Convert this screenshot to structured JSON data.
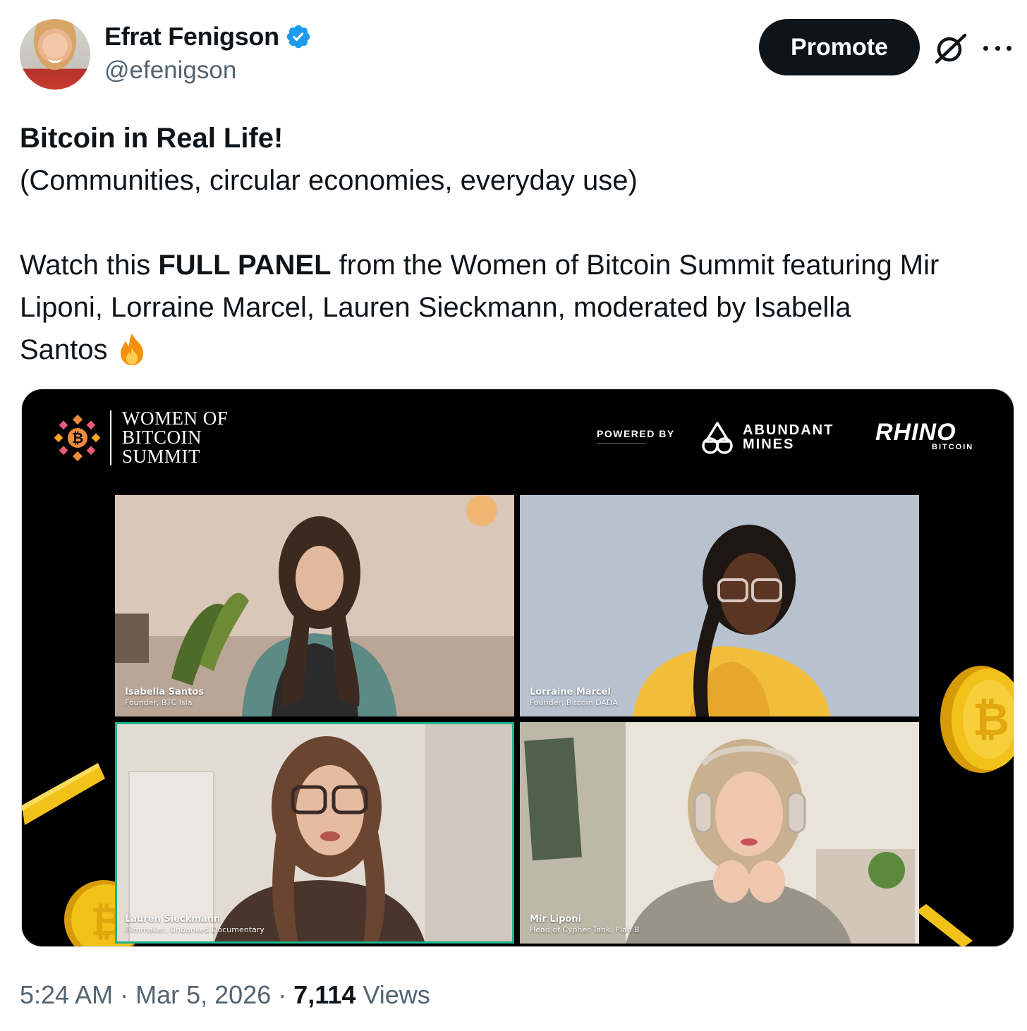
{
  "author": {
    "display_name": "Efrat Fenigson",
    "handle": "@efenigson",
    "verified": true,
    "avatar_icon": "profile-photo"
  },
  "actions": {
    "promote_label": "Promote",
    "grok_icon": "grok-icon",
    "more_icon": "more-icon"
  },
  "tweet": {
    "heading": "Bitcoin in Real Life!",
    "subheading": "(Communities, circular economies, everyday use)",
    "line1_a": "Watch this ",
    "line1_bold": "FULL PANEL",
    "line1_b": " from the Women of Bitcoin Summit featuring Mir",
    "line2": "Liponi, Lorraine Marcel, Lauren Sieckmann, moderated by Isabella",
    "line3": "Santos",
    "emoji": "fire-emoji"
  },
  "media": {
    "event_title": [
      "WOMEN OF",
      "BITCOIN",
      "SUMMIT"
    ],
    "powered_by": "POWERED BY",
    "sponsor1": [
      "ABUNDANT",
      "MINES"
    ],
    "sponsor2": "RHINO",
    "sponsor2_sub": "BITCOIN",
    "participants": [
      {
        "name": "Isabella Santos",
        "role": "Founder, BTC Isla"
      },
      {
        "name": "Lorraine Marcel",
        "role": "Founder, Bitcoin DADA"
      },
      {
        "name": "Lauren Sieckmann",
        "role": "Filmmaker, Unbanked Documentary",
        "active_speaker": true
      },
      {
        "name": "Mir Liponi",
        "role": "Head of Cypher Tank, Plan B"
      }
    ],
    "colors": {
      "active_speaker_border": "#1fb28a",
      "coin": "#f2c21b"
    }
  },
  "meta": {
    "time": "5:24 AM",
    "date": "Mar 5, 2026",
    "separator": "·",
    "views_count": "7,114",
    "views_label": "Views"
  }
}
